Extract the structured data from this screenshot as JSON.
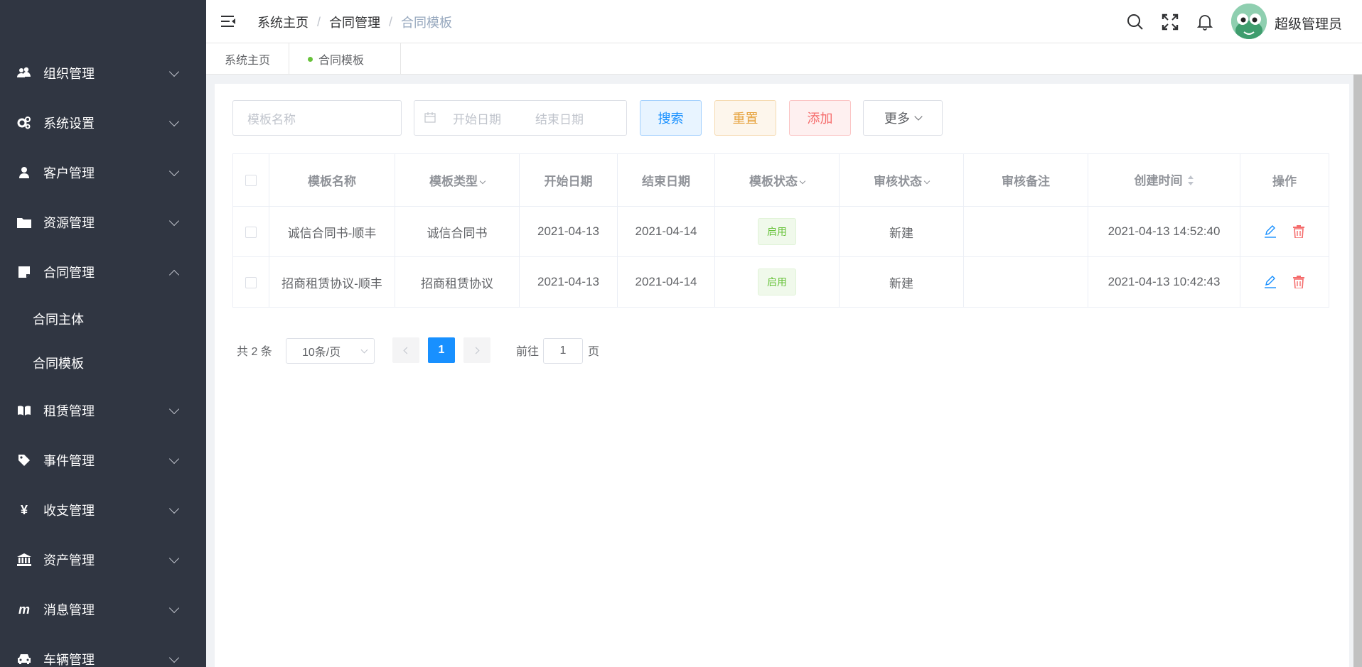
{
  "sidebar": {
    "menu": [
      {
        "label": "组织管理",
        "icon": "users-icon"
      },
      {
        "label": "系统设置",
        "icon": "gears-icon"
      },
      {
        "label": "客户管理",
        "icon": "user-icon"
      },
      {
        "label": "资源管理",
        "icon": "folder-icon"
      },
      {
        "label": "合同管理",
        "icon": "contract-icon"
      },
      {
        "label": "租赁管理",
        "icon": "book-icon"
      },
      {
        "label": "事件管理",
        "icon": "tag-icon"
      },
      {
        "label": "收支管理",
        "icon": "yen-icon"
      },
      {
        "label": "资产管理",
        "icon": "bank-icon"
      },
      {
        "label": "消息管理",
        "icon": "message-icon"
      },
      {
        "label": "车辆管理",
        "icon": "car-icon"
      }
    ],
    "submenu": [
      "合同主体",
      "合同模板"
    ]
  },
  "header": {
    "breadcrumb": [
      "系统主页",
      "合同管理",
      "合同模板"
    ],
    "separator": "/",
    "username": "超级管理员"
  },
  "tags": [
    "系统主页",
    "合同模板"
  ],
  "search": {
    "name_placeholder": "模板名称",
    "start_placeholder": "开始日期",
    "end_placeholder": "结束日期",
    "search_label": "搜索",
    "reset_label": "重置",
    "add_label": "添加",
    "more_label": "更多"
  },
  "table": {
    "columns": [
      "模板名称",
      "模板类型",
      "开始日期",
      "结束日期",
      "模板状态",
      "审核状态",
      "审核备注",
      "创建时间",
      "操作"
    ],
    "rows": [
      {
        "name": "诚信合同书-顺丰",
        "type": "诚信合同书",
        "start": "2021-04-13",
        "end": "2021-04-14",
        "status": "启用",
        "audit": "新建",
        "remark": "",
        "created": "2021-04-13 14:52:40"
      },
      {
        "name": "招商租赁协议-顺丰",
        "type": "招商租赁协议",
        "start": "2021-04-13",
        "end": "2021-04-14",
        "status": "启用",
        "audit": "新建",
        "remark": "",
        "created": "2021-04-13 10:42:43"
      }
    ]
  },
  "pagination": {
    "total_text": "共 2 条",
    "page_size": "10条/页",
    "current_page": "1",
    "goto_label": "前往",
    "goto_value": "1",
    "page_suffix": "页"
  },
  "colors": {
    "sidebar_bg": "#303642",
    "primary": "#1890ff",
    "warning": "#e6a23c",
    "danger": "#f56c6c",
    "success": "#67c23a"
  }
}
